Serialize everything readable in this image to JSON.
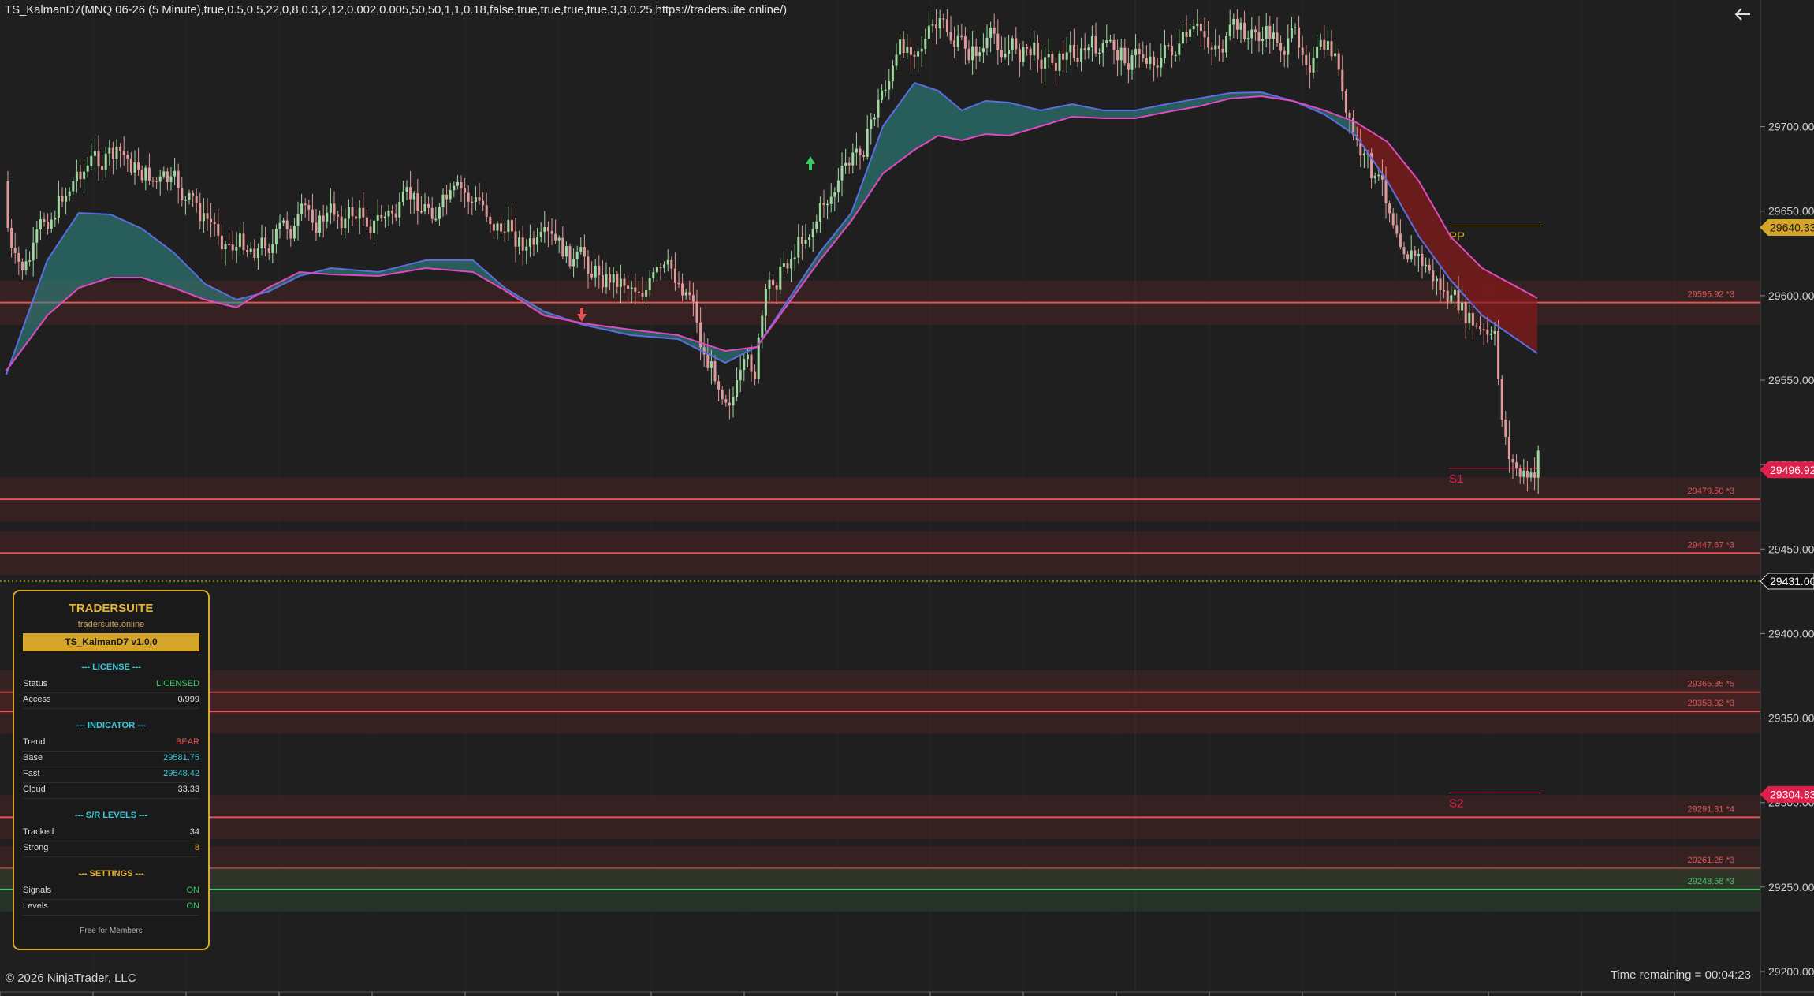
{
  "indicator_title": "TS_KalmanD7(MNQ 06-26 (5 Minute),true,0.5,0.5,22,0,8,0.3,2,12,0.002,0.005,50,50,1,1,0.18,false,true,true,true,true,3,3,0.25,https://tradersuite.online/)",
  "copyright": "© 2026 NinjaTrader, LLC",
  "time_remaining": "Time remaining = 00:04:23",
  "colors": {
    "background": "#1f1f1f",
    "bull_candle": "#9fd8a0",
    "bear_candle": "#e19a9a",
    "resistance": "#e05555",
    "support": "#3cc864",
    "fast_line": "#e04ac0",
    "base_line": "#5a6ee0",
    "bull_cloud": "#2e8f8a",
    "bear_cloud": "#8a1a1a",
    "panel_gold": "#d4a52a"
  },
  "price_axis": {
    "ticks": [
      "29700.00",
      "29650.00",
      "29600.00",
      "29550.00",
      "29500.00",
      "29450.00",
      "29400.00",
      "29350.00",
      "29300.00",
      "29250.00",
      "29200.00"
    ],
    "markers": [
      {
        "price": 29640.33,
        "label": "29640.33",
        "bg": "#d4a52a",
        "fg": "#1a1a1a"
      },
      {
        "price": 29496.92,
        "label": "29496.92",
        "bg": "#e0204a",
        "fg": "#ffffff"
      },
      {
        "price": 29431.0,
        "label": "29431.00",
        "bg": "#111111",
        "fg": "#ffffff"
      },
      {
        "price": 29304.83,
        "label": "29304.83",
        "bg": "#e0204a",
        "fg": "#ffffff"
      }
    ]
  },
  "sr_levels": [
    {
      "price": 29595.92,
      "label": "29595.92 *3",
      "type": "resistance"
    },
    {
      "price": 29479.5,
      "label": "29479.50 *3",
      "type": "resistance"
    },
    {
      "price": 29447.67,
      "label": "29447.67 *3",
      "type": "resistance"
    },
    {
      "price": 29365.35,
      "label": "29365.35 *5",
      "type": "resistance"
    },
    {
      "price": 29353.92,
      "label": "29353.92 *3",
      "type": "resistance"
    },
    {
      "price": 29291.31,
      "label": "29291.31 *4",
      "type": "resistance"
    },
    {
      "price": 29261.25,
      "label": "29261.25 *3",
      "type": "resistance"
    },
    {
      "price": 29248.58,
      "label": "29248.58 *3",
      "type": "support"
    }
  ],
  "pivots": [
    {
      "label": "PP",
      "price": 29640.33,
      "color": "#d4a52a"
    },
    {
      "label": "S1",
      "price": 29496.92,
      "color": "#e0204a"
    },
    {
      "label": "S2",
      "price": 29304.83,
      "color": "#e0204a"
    }
  ],
  "last_price": 29431.0,
  "panel": {
    "brand": "TRADERSUITE",
    "site": "tradersuite.online",
    "version": "TS_KalmanD7 v1.0.0",
    "license": {
      "heading": "--- LICENSE ---",
      "status_label": "Status",
      "status_value": "LICENSED",
      "access_label": "Access",
      "access_value": "0/999"
    },
    "indicator": {
      "heading": "--- INDICATOR ---",
      "trend_label": "Trend",
      "trend_value": "BEAR",
      "base_label": "Base",
      "base_value": "29581.75",
      "fast_label": "Fast",
      "fast_value": "29548.42",
      "cloud_label": "Cloud",
      "cloud_value": "33.33"
    },
    "levels": {
      "heading": "--- S/R LEVELS ---",
      "tracked_label": "Tracked",
      "tracked_value": "34",
      "strong_label": "Strong",
      "strong_value": "8"
    },
    "settings": {
      "heading": "--- SETTINGS ---",
      "signals_label": "Signals",
      "signals_value": "ON",
      "levels_label": "Levels",
      "levels_value": "ON"
    },
    "footer": "Free for Members"
  }
}
